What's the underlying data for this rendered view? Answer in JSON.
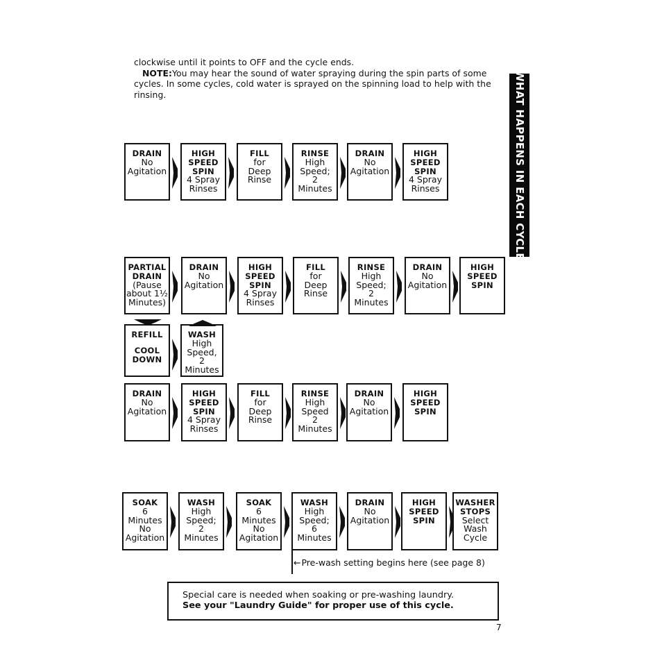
{
  "intro": {
    "line1": "clockwise until it points to OFF and the cycle ends.",
    "note_label": "NOTE:",
    "note_text": "You may hear the sound of water spraying during the spin parts of some cycles. In some cycles, cold water is sprayed on the spinning load to help with the rinsing."
  },
  "side_tab": {
    "label": "WHAT HAPPENS IN EACH CYCLE"
  },
  "diagram_1": {
    "steps": [
      {
        "title": "DRAIN",
        "lines": [
          "No",
          "Agitation"
        ]
      },
      {
        "title": "HIGH SPEED SPIN",
        "lines": [
          "4 Spray",
          "Rinses"
        ]
      },
      {
        "title": "FILL",
        "lines": [
          "for",
          "Deep",
          "Rinse"
        ]
      },
      {
        "title": "RINSE",
        "lines": [
          "High",
          "Speed;",
          "2",
          "Minutes"
        ]
      },
      {
        "title": "DRAIN",
        "lines": [
          "No",
          "Agitation"
        ]
      },
      {
        "title": "HIGH SPEED SPIN",
        "lines": [
          "4 Spray",
          "Rinses"
        ]
      }
    ]
  },
  "diagram_2": {
    "steps": [
      {
        "title": "PARTIAL DRAIN",
        "lines": [
          "(Pause",
          "about 1½",
          "Minutes)"
        ]
      },
      {
        "title": "DRAIN",
        "lines": [
          "No",
          "Agitation"
        ]
      },
      {
        "title": "HIGH SPEED SPIN",
        "lines": [
          "4 Spray",
          "Rinses"
        ]
      },
      {
        "title": "FILL",
        "lines": [
          "for",
          "Deep",
          "Rinse"
        ]
      },
      {
        "title": "RINSE",
        "lines": [
          "High",
          "Speed;",
          "2",
          "Minutes"
        ]
      },
      {
        "title": "DRAIN",
        "lines": [
          "No",
          "Agitation"
        ]
      },
      {
        "title": "HIGH SPEED SPIN",
        "lines": []
      }
    ],
    "loop_steps": [
      {
        "title": "REFILL",
        "lines": [
          "COOL DOWN"
        ]
      },
      {
        "title": "WASH",
        "lines": [
          "High",
          "Speed,",
          "2",
          "Minutes"
        ]
      }
    ]
  },
  "diagram_3": {
    "steps": [
      {
        "title": "DRAIN",
        "lines": [
          "No",
          "Agitation"
        ]
      },
      {
        "title": "HIGH SPEED SPIN",
        "lines": [
          "4 Spray",
          "Rinses"
        ]
      },
      {
        "title": "FILL",
        "lines": [
          "for",
          "Deep",
          "Rinse"
        ]
      },
      {
        "title": "RINSE",
        "lines": [
          "High",
          "Speed",
          "2",
          "Minutes"
        ]
      },
      {
        "title": "DRAIN",
        "lines": [
          "No",
          "Agitation"
        ]
      },
      {
        "title": "HIGH SPEED SPIN",
        "lines": []
      }
    ]
  },
  "diagram_4": {
    "steps": [
      {
        "title": "SOAK",
        "lines": [
          "6",
          "Minutes",
          "No",
          "Agitation"
        ]
      },
      {
        "title": "WASH",
        "lines": [
          "High",
          "Speed;",
          "2",
          "Minutes"
        ]
      },
      {
        "title": "SOAK",
        "lines": [
          "6",
          "Minutes",
          "No",
          "Agitation"
        ]
      },
      {
        "title": "WASH",
        "lines": [
          "High",
          "Speed;",
          "6",
          "Minutes"
        ]
      },
      {
        "title": "DRAIN",
        "lines": [
          "No",
          "Agitation"
        ]
      },
      {
        "title": "HIGH SPEED SPIN",
        "lines": []
      },
      {
        "title": "WASHER STOPS",
        "lines": [
          "Select",
          "Wash",
          "Cycle"
        ]
      }
    ],
    "prewash_note": "Pre-wash setting begins here (see page 8)"
  },
  "care_box": {
    "line1": "Special care is needed when soaking or pre-washing laundry.",
    "line2": "See your \"Laundry Guide\" for proper use of this cycle."
  },
  "page_number": "7"
}
